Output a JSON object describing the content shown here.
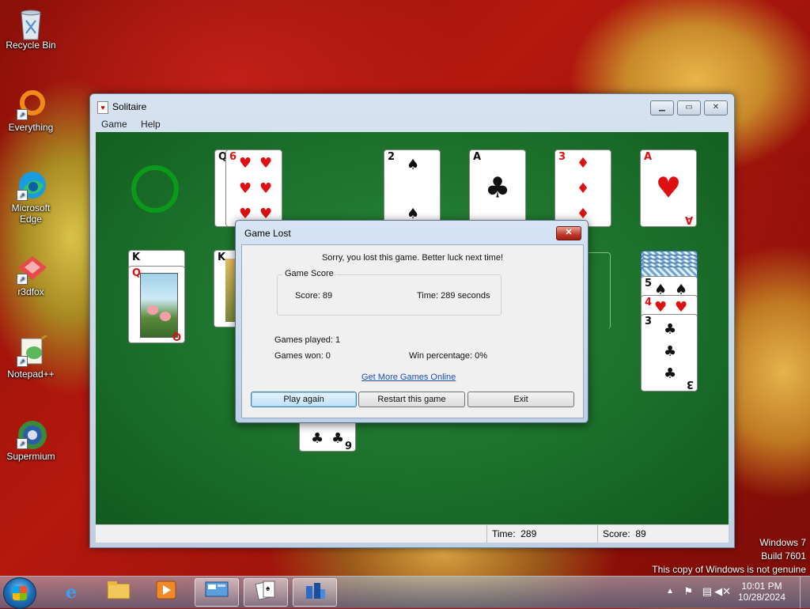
{
  "desktop": {
    "icons": [
      {
        "label": "Recycle Bin",
        "icon": "recycle-bin-icon"
      },
      {
        "label": "Everything",
        "icon": "everything-icon"
      },
      {
        "label": "Microsoft Edge",
        "icon": "edge-icon"
      },
      {
        "label": "r3dfox",
        "icon": "r3dfox-icon"
      },
      {
        "label": "Notepad++",
        "icon": "notepadpp-icon"
      },
      {
        "label": "Supermium",
        "icon": "supermium-icon"
      }
    ]
  },
  "window": {
    "title": "Solitaire",
    "menu": [
      "Game",
      "Help"
    ],
    "status": {
      "time_label": "Time:",
      "time_value": "289",
      "score_label": "Score:",
      "score_value": "89"
    }
  },
  "cards": {
    "waste_top": {
      "rank": "6",
      "suit": "♥",
      "under_rank": "Q",
      "under_suit": "♣"
    },
    "foundations": [
      {
        "rank": "2",
        "suit": "♠"
      },
      {
        "rank": "A",
        "suit": "♣"
      },
      {
        "rank": "3",
        "suit": "♦"
      },
      {
        "rank": "A",
        "suit": "♥"
      }
    ],
    "tableau_1": [
      {
        "rank": "K",
        "suit": "♠"
      },
      {
        "rank": "Q",
        "suit": "♥"
      }
    ],
    "tableau_2": [
      {
        "rank": "K",
        "suit": "♣"
      }
    ],
    "tableau_6_bottom": {
      "rank": "6",
      "suit": "♣"
    },
    "tableau_7": [
      {
        "rank": "5",
        "suit": "♠"
      },
      {
        "rank": "4",
        "suit": "♥"
      },
      {
        "rank": "3",
        "suit": "♣"
      }
    ]
  },
  "dialog": {
    "title": "Game Lost",
    "message": "Sorry, you lost this game. Better luck next time!",
    "group_title": "Game Score",
    "score": "Score: 89",
    "time": "Time:  289 seconds",
    "games_played": "Games played: 1",
    "games_won": "Games won: 0",
    "win_percentage": "Win percentage: 0%",
    "link": "Get More Games Online",
    "buttons": {
      "play_again": "Play again",
      "restart": "Restart this game",
      "exit": "Exit"
    }
  },
  "taskbar": {
    "clock_time": "10:01 PM",
    "clock_date": "10/28/2024"
  },
  "watermark": {
    "line1": "Windows 7",
    "line2": "Build 7601",
    "line3": "This copy of Windows is not genuine"
  }
}
